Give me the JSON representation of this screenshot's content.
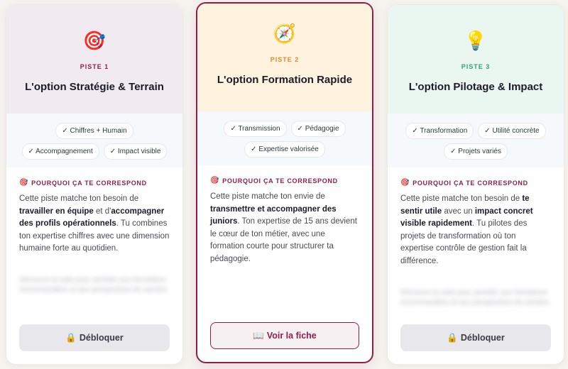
{
  "cards": [
    {
      "emoji": "🎯",
      "emoji_icon": "target-icon",
      "label": "PISTE 1",
      "title": "L'option Stratégie & Terrain",
      "tags": [
        "✓ Chiffres + Humain",
        "✓ Accompagnement",
        "✓ Impact visible"
      ],
      "why_heading": "POURQUOI ÇA TE CORRESPOND",
      "desc": [
        {
          "t": "Cette piste matche ton besoin de ",
          "b": false
        },
        {
          "t": "travailler en équipe",
          "b": true
        },
        {
          "t": " et d'",
          "b": false
        },
        {
          "t": "accompagner des profils opérationnels",
          "b": true
        },
        {
          "t": ". Tu combines ton expertise chiffres avec une dimension humaine forte au quotidien.",
          "b": false
        }
      ],
      "blurred": "Découvre la suite pour accéder aux formations recommandées et aux perspectives de carrière.",
      "button_icon": "🔒",
      "button": "Débloquer"
    },
    {
      "emoji": "🧭",
      "emoji_icon": "compass-icon",
      "label": "PISTE 2",
      "title": "L'option Formation Rapide",
      "tags": [
        "✓ Transmission",
        "✓ Pédagogie",
        "✓ Expertise valorisée"
      ],
      "why_heading": "POURQUOI ÇA TE CORRESPOND",
      "desc": [
        {
          "t": "Cette piste matche ton envie de ",
          "b": false
        },
        {
          "t": "transmettre et accompagner des juniors",
          "b": true
        },
        {
          "t": ". Ton expertise de 15 ans devient le cœur de ton métier, avec une formation courte pour structurer ta pédagogie.",
          "b": false
        }
      ],
      "blurred": "",
      "button_icon": "📖",
      "button": "Voir la fiche"
    },
    {
      "emoji": "💡",
      "emoji_icon": "lightbulb-icon",
      "label": "PISTE 3",
      "title": "L'option Pilotage & Impact",
      "tags": [
        "✓ Transformation",
        "✓ Utilité concrète",
        "✓ Projets variés"
      ],
      "why_heading": "POURQUOI ÇA TE CORRESPOND",
      "desc": [
        {
          "t": "Cette piste matche ton besoin de ",
          "b": false
        },
        {
          "t": "te sentir utile",
          "b": true
        },
        {
          "t": " avec un ",
          "b": false
        },
        {
          "t": "impact concret visible rapidement",
          "b": true
        },
        {
          "t": ". Tu pilotes des projets de transformation où ton expertise contrôle de gestion fait la différence.",
          "b": false
        }
      ],
      "blurred": "Découvre la suite pour accéder aux formations recommandées et aux perspectives de carrière.",
      "button_icon": "🔒",
      "button": "Débloquer"
    }
  ],
  "why_icon": "🎯",
  "colors": {
    "accent": "#8e1f4b",
    "piste2": "#d98b2b",
    "piste3": "#2fa37a"
  }
}
